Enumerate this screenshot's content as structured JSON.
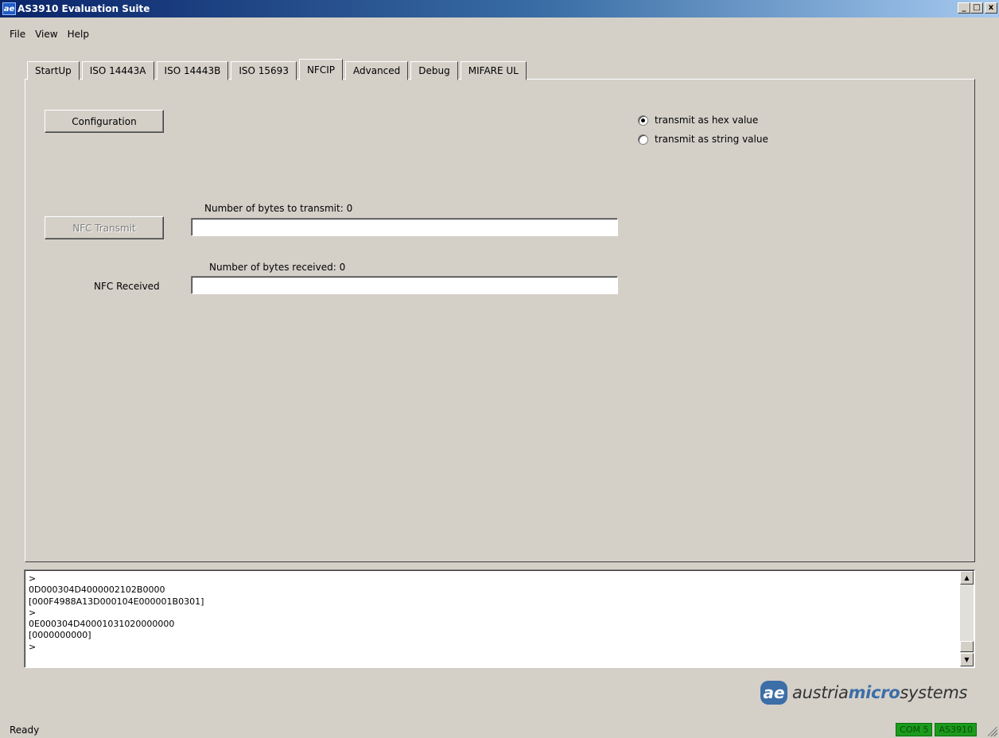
{
  "window": {
    "title": "AS3910 Evaluation Suite",
    "icon_glyph": "ae",
    "controls": {
      "minimize": "_",
      "maximize": "□",
      "close": "x"
    }
  },
  "menu": [
    "File",
    "View",
    "Help"
  ],
  "tabs": [
    {
      "label": "StartUp",
      "active": false
    },
    {
      "label": "ISO 14443A",
      "active": false
    },
    {
      "label": "ISO 14443B",
      "active": false
    },
    {
      "label": "ISO 15693",
      "active": false
    },
    {
      "label": "NFCIP",
      "active": true
    },
    {
      "label": "Advanced",
      "active": false
    },
    {
      "label": "Debug",
      "active": false
    },
    {
      "label": "MIFARE UL",
      "active": false
    }
  ],
  "nfcip": {
    "configuration_label": "Configuration",
    "transmit_button_label": "NFC Transmit",
    "transmit_bytes_label": "Number of bytes to transmit: 0",
    "transmit_value": "",
    "received_label": "NFC Received",
    "received_bytes_label": "Number of bytes received: 0",
    "received_value": "",
    "radio_hex_label": "transmit as hex value",
    "radio_string_label": "transmit as string value",
    "selected_mode": "hex"
  },
  "log": {
    "lines": [
      ">",
      "0D000304D4000002102B0000",
      "[000F4988A13D000104E000001B0301]",
      ">",
      "0E000304D40001031020000000",
      "[0000000000]",
      ">"
    ],
    "scroll_up": "▲",
    "scroll_down": "▼"
  },
  "logo": {
    "mark": "ae",
    "text_pre": "austria",
    "text_em": "micro",
    "text_post": "systems"
  },
  "status": {
    "text": "Ready",
    "badges": [
      "COM 5",
      "AS3910"
    ]
  },
  "colors": {
    "badge_green": "#1b9b1b",
    "logo_blue": "#3c6ea8",
    "title_dark": "#0a246a"
  }
}
